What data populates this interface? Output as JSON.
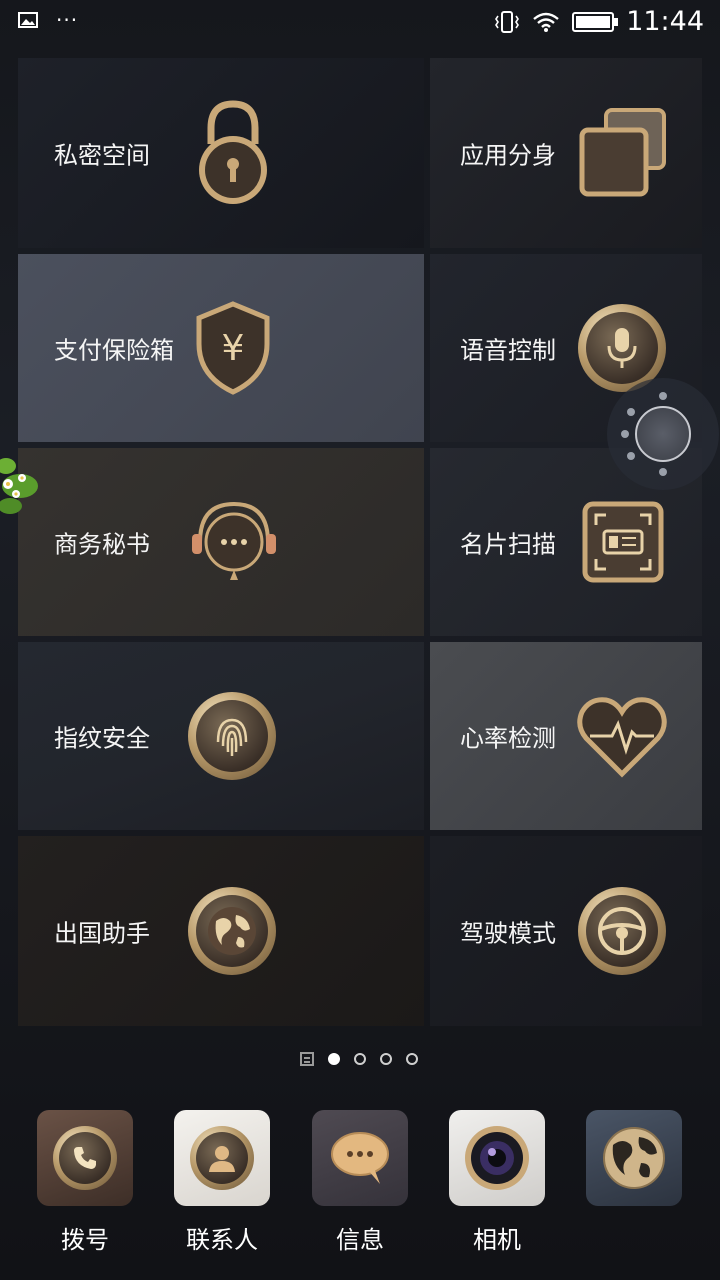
{
  "status": {
    "time": "11:44"
  },
  "tiles": [
    {
      "label": "私密空间",
      "icon": "lock-icon"
    },
    {
      "label": "应用分身",
      "icon": "app-clone-icon"
    },
    {
      "label": "支付保险箱",
      "icon": "yuan-shield-icon"
    },
    {
      "label": "语音控制",
      "icon": "microphone-icon"
    },
    {
      "label": "商务秘书",
      "icon": "headset-icon"
    },
    {
      "label": "名片扫描",
      "icon": "card-scan-icon"
    },
    {
      "label": "指纹安全",
      "icon": "fingerprint-icon"
    },
    {
      "label": "心率检测",
      "icon": "heart-rate-icon"
    },
    {
      "label": "出国助手",
      "icon": "globe-icon"
    },
    {
      "label": "驾驶模式",
      "icon": "steering-wheel-icon"
    }
  ],
  "pager": {
    "pages": 4,
    "active": 1
  },
  "dock": [
    {
      "label": "拨号",
      "icon": "phone-icon"
    },
    {
      "label": "联系人",
      "icon": "contact-icon"
    },
    {
      "label": "信息",
      "icon": "message-icon"
    },
    {
      "label": "相机",
      "icon": "camera-icon"
    },
    {
      "label": "",
      "icon": "world-globe-icon"
    }
  ],
  "colors": {
    "gold": "#c9a878",
    "tileDark": "#1c1f27",
    "tileHighlight": "#4a4f5c"
  }
}
